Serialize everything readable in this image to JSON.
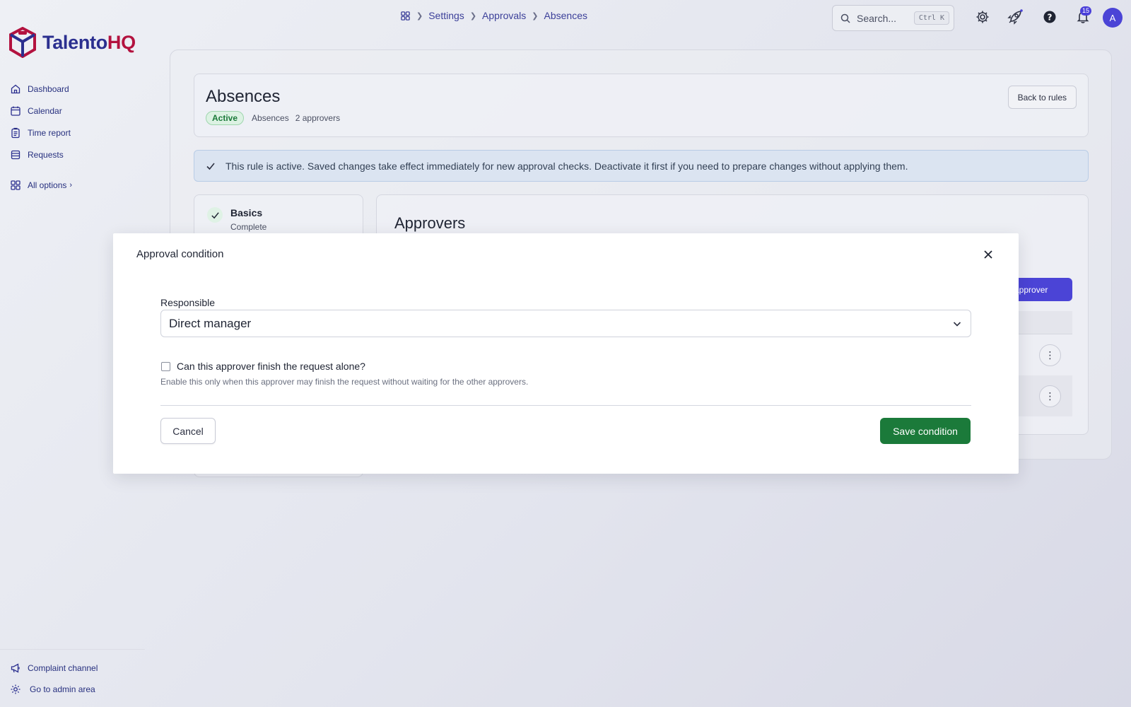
{
  "app": {
    "logo_main": "Talento",
    "logo_accent": "HQ"
  },
  "sidebar": {
    "items": [
      {
        "label": "Dashboard",
        "icon": "home-icon"
      },
      {
        "label": "Calendar",
        "icon": "calendar-icon"
      },
      {
        "label": "Time report",
        "icon": "clipboard-icon"
      },
      {
        "label": "Requests",
        "icon": "list-icon"
      }
    ],
    "all_options": "All options",
    "footer": [
      {
        "label": "Complaint channel",
        "icon": "megaphone-icon"
      },
      {
        "label": "Go to admin area",
        "icon": "gear-icon"
      }
    ]
  },
  "topbar": {
    "breadcrumb": [
      "Settings",
      "Approvals",
      "Absences"
    ],
    "search_placeholder": "Search...",
    "search_shortcut": "Ctrl K",
    "notification_count": "15",
    "avatar_initial": "A"
  },
  "rule": {
    "title": "Absences",
    "status": "Active",
    "type": "Absences",
    "approvers_count": "2 approvers",
    "back_button": "Back to rules",
    "alert": "This rule is active. Saved changes take effect immediately for new approval checks. Deactivate it first if you need to prepare changes without applying them."
  },
  "steps": {
    "basics_title": "Basics",
    "basics_status": "Complete"
  },
  "approvers": {
    "title": "Approvers",
    "add_button_partial": "d approver",
    "kebab": "⋮"
  },
  "modal": {
    "title": "Approval condition",
    "field_label": "Responsible",
    "selected_value": "Direct manager",
    "checkbox_label": "Can this approver finish the request alone?",
    "checkbox_checked": false,
    "hint": "Enable this only when this approver may finish the request without waiting for the other approvers.",
    "cancel": "Cancel",
    "save": "Save condition"
  },
  "colors": {
    "brand": "#2b2f8f",
    "brand_accent": "#b3123f",
    "primary": "#4b44d6",
    "success": "#1b7a3a"
  }
}
